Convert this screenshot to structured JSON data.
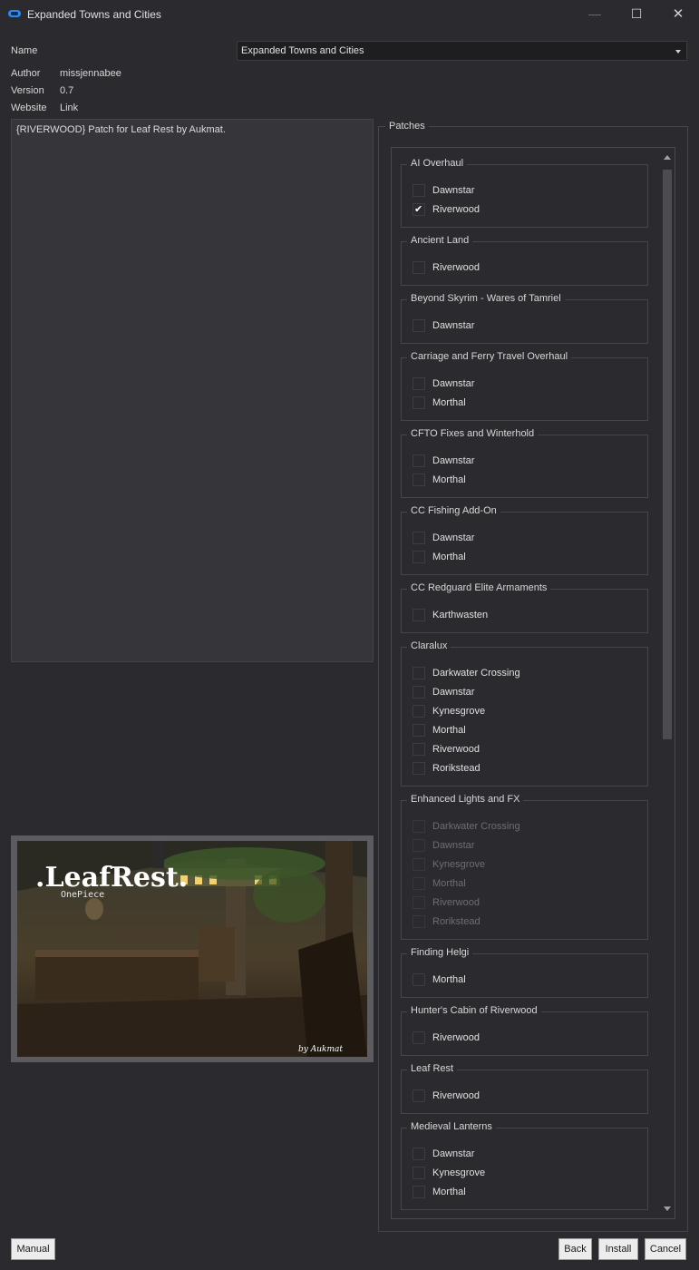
{
  "window": {
    "title": "Expanded Towns and Cities",
    "minimize": "—",
    "maximize": "☐",
    "close": "✕"
  },
  "info": {
    "name_label": "Name",
    "name_value": "Expanded Towns and Cities",
    "author_label": "Author",
    "author_value": "missjennabee",
    "version_label": "Version",
    "version_value": "0.7",
    "website_label": "Website",
    "website_value": "Link"
  },
  "description": "{RIVERWOOD} Patch for Leaf Rest by Aukmat.",
  "preview": {
    "title_text": ".LeafRest.",
    "subtitle_text": "OnePiece",
    "signature_text": "by Aukmat"
  },
  "patches": {
    "title": "Patches",
    "groups": [
      {
        "title": "AI Overhaul",
        "options": [
          {
            "label": "Dawnstar",
            "checked": false
          },
          {
            "label": "Riverwood",
            "checked": true
          }
        ]
      },
      {
        "title": "Ancient Land",
        "options": [
          {
            "label": "Riverwood",
            "checked": false
          }
        ]
      },
      {
        "title": "Beyond Skyrim - Wares of Tamriel",
        "options": [
          {
            "label": "Dawnstar",
            "checked": false
          }
        ]
      },
      {
        "title": "Carriage and Ferry Travel Overhaul",
        "options": [
          {
            "label": "Dawnstar",
            "checked": false
          },
          {
            "label": "Morthal",
            "checked": false
          }
        ]
      },
      {
        "title": "CFTO Fixes and Winterhold",
        "options": [
          {
            "label": "Dawnstar",
            "checked": false
          },
          {
            "label": "Morthal",
            "checked": false
          }
        ]
      },
      {
        "title": "CC Fishing Add-On",
        "options": [
          {
            "label": "Dawnstar",
            "checked": false
          },
          {
            "label": "Morthal",
            "checked": false
          }
        ]
      },
      {
        "title": "CC Redguard Elite Armaments",
        "options": [
          {
            "label": "Karthwasten",
            "checked": false
          }
        ]
      },
      {
        "title": "Claralux",
        "options": [
          {
            "label": "Darkwater Crossing",
            "checked": false
          },
          {
            "label": "Dawnstar",
            "checked": false
          },
          {
            "label": "Kynesgrove",
            "checked": false
          },
          {
            "label": "Morthal",
            "checked": false
          },
          {
            "label": "Riverwood",
            "checked": false
          },
          {
            "label": "Rorikstead",
            "checked": false
          }
        ]
      },
      {
        "title": "Enhanced Lights and FX",
        "disabled": true,
        "options": [
          {
            "label": "Darkwater Crossing",
            "checked": false
          },
          {
            "label": "Dawnstar",
            "checked": false
          },
          {
            "label": "Kynesgrove",
            "checked": false
          },
          {
            "label": "Morthal",
            "checked": false
          },
          {
            "label": "Riverwood",
            "checked": false
          },
          {
            "label": "Rorikstead",
            "checked": false
          }
        ]
      },
      {
        "title": "Finding Helgi",
        "options": [
          {
            "label": "Morthal",
            "checked": false
          }
        ]
      },
      {
        "title": "Hunter's Cabin of Riverwood",
        "options": [
          {
            "label": "Riverwood",
            "checked": false
          }
        ]
      },
      {
        "title": "Leaf Rest",
        "options": [
          {
            "label": "Riverwood",
            "checked": false
          }
        ]
      },
      {
        "title": "Medieval Lanterns",
        "options": [
          {
            "label": "Dawnstar",
            "checked": false
          },
          {
            "label": "Kynesgrove",
            "checked": false
          },
          {
            "label": "Morthal",
            "checked": false
          }
        ]
      }
    ]
  },
  "buttons": {
    "manual": "Manual",
    "back": "Back",
    "install": "Install",
    "cancel": "Cancel"
  }
}
